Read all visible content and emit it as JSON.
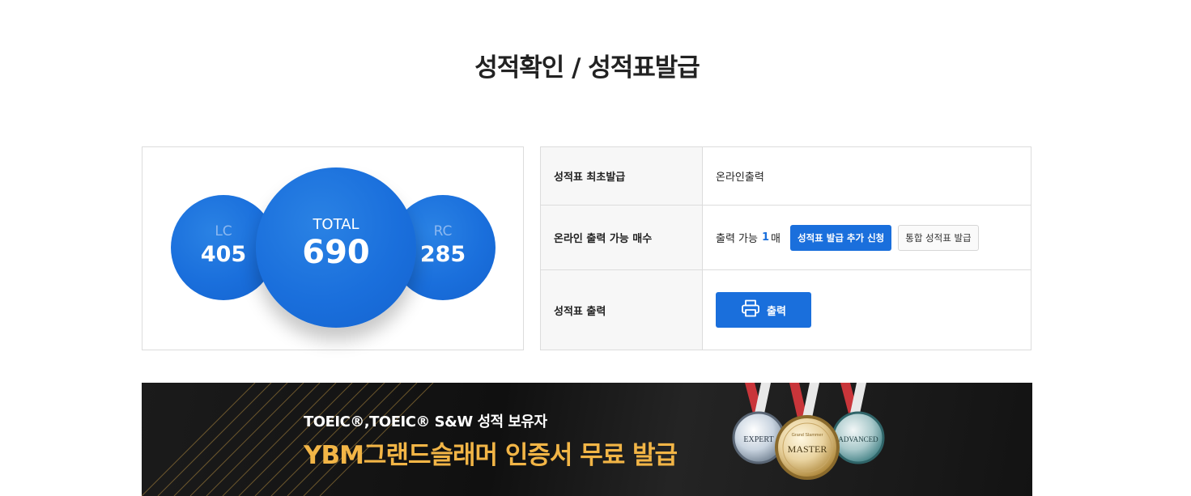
{
  "page": {
    "title": "성적확인 / 성적표발급"
  },
  "scores": {
    "lc": {
      "label": "LC",
      "value": "405"
    },
    "total": {
      "label": "TOTAL",
      "value": "690"
    },
    "rc": {
      "label": "RC",
      "value": "285"
    }
  },
  "info_table": {
    "rows": [
      {
        "header": "성적표 최초발급",
        "value": "온라인출력"
      },
      {
        "header": "온라인 출력 가능 매수",
        "prefix": "출력 가능",
        "count": "1",
        "suffix": "매",
        "apply_button": "성적표 발급 추가 신청",
        "integrated_button": "통합 성적표 발급"
      },
      {
        "header": "성적표 출력",
        "print_button": "출력"
      }
    ]
  },
  "banner": {
    "line1": "TOEIC®,TOEIC® S&W 성적 보유자",
    "line2": "YBM그랜드슬래머 인증서 무료 발급",
    "medals": [
      "EXPERT",
      "MASTER",
      "ADVANCED"
    ],
    "medal_badge_text": "Grand Slammer"
  },
  "colors": {
    "accent": "#1a6fdc",
    "banner_gold": "#f2b546"
  },
  "icons": {
    "print": "printer-icon"
  }
}
